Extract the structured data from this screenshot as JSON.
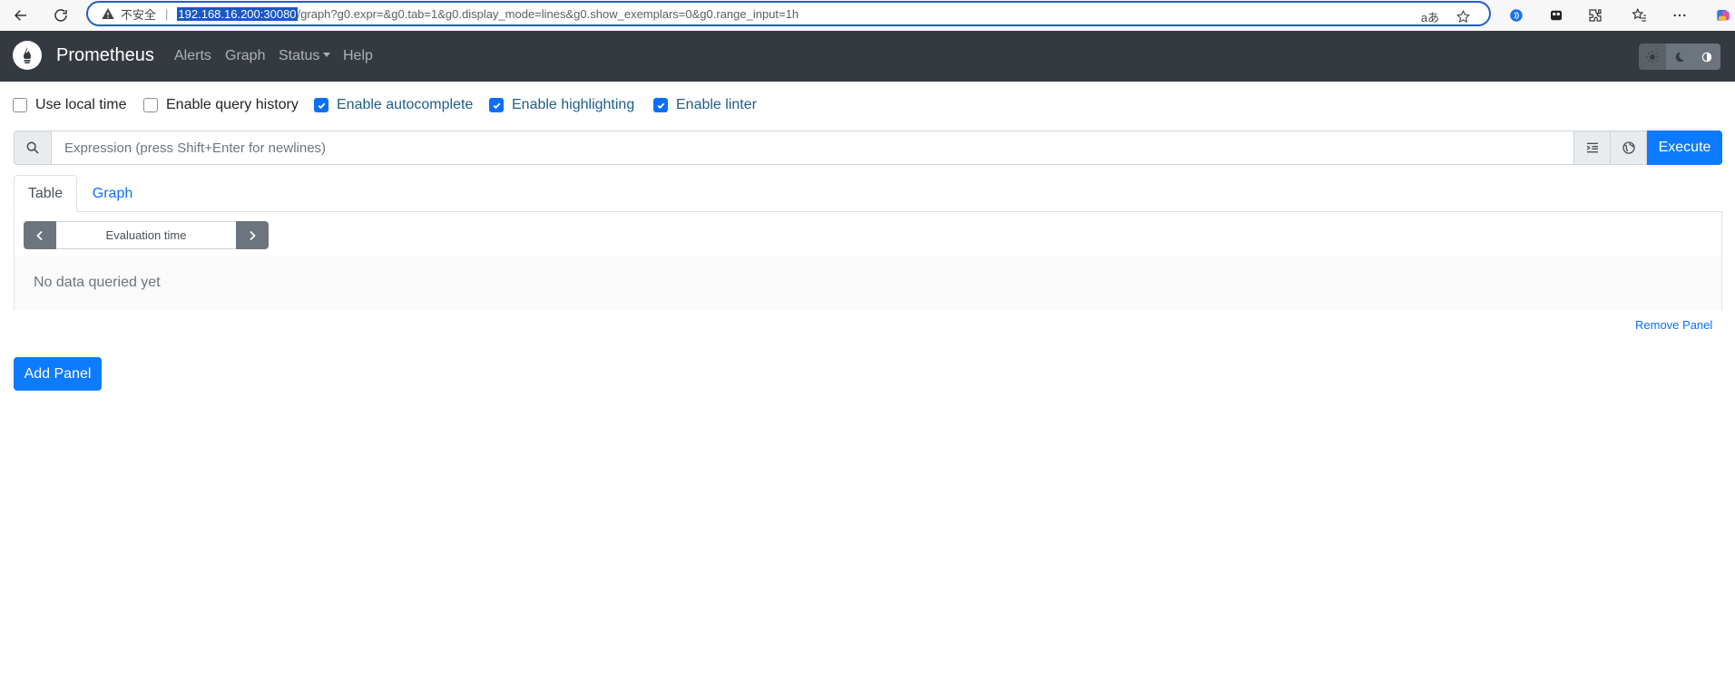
{
  "browser": {
    "security_label": "不安全",
    "url_host": "192.168.16.200:30080",
    "url_path": "/graph?g0.expr=&g0.tab=1&g0.display_mode=lines&g0.show_exemplars=0&g0.range_input=1h",
    "read_aloud_label": "aあ"
  },
  "navbar": {
    "brand": "Prometheus",
    "links": [
      {
        "label": "Alerts"
      },
      {
        "label": "Graph"
      },
      {
        "label": "Status"
      },
      {
        "label": "Help"
      }
    ],
    "theme_buttons": [
      "sun-icon",
      "moon-icon",
      "contrast-icon"
    ],
    "theme_active": "sun-icon"
  },
  "options": [
    {
      "label": "Use local time",
      "checked": false
    },
    {
      "label": "Enable query history",
      "checked": false
    },
    {
      "label": "Enable autocomplete",
      "checked": true
    },
    {
      "label": "Enable highlighting",
      "checked": true
    },
    {
      "label": "Enable linter",
      "checked": true
    }
  ],
  "expression": {
    "value": "",
    "placeholder": "Expression (press Shift+Enter for newlines)",
    "execute_label": "Execute"
  },
  "panel": {
    "tabs": [
      {
        "label": "Table",
        "active": true
      },
      {
        "label": "Graph",
        "active": false
      }
    ],
    "eval_time_placeholder": "Evaluation time",
    "empty_message": "No data queried yet",
    "remove_label": "Remove Panel"
  },
  "add_panel_label": "Add Panel",
  "colors": {
    "navbar_bg": "#343a40",
    "primary": "#0d7bff",
    "link": "#0d6efd",
    "url_highlight": "#1a57c4"
  }
}
